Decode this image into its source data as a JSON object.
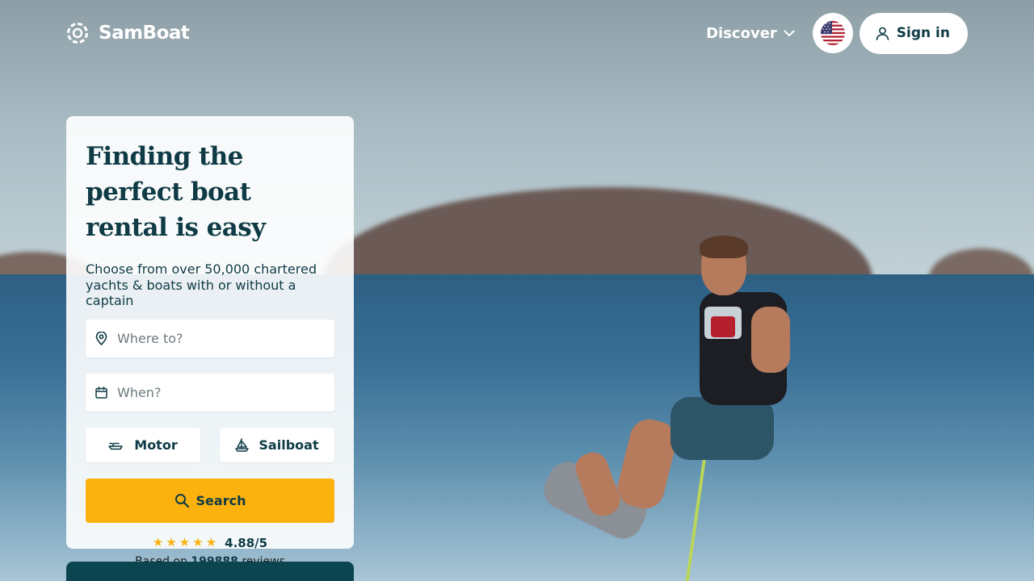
{
  "brand": {
    "name": "SamBoat"
  },
  "nav": {
    "discover_label": "Discover",
    "language_flag": "us-flag-icon",
    "signin_label": "Sign in"
  },
  "search_card": {
    "title": "Finding the perfect boat rental is easy",
    "subtitle": "Choose from over 50,000 chartered yachts & boats with or without a captain",
    "where_placeholder": "Where to?",
    "when_placeholder": "When?",
    "boat_types": [
      "Motor",
      "Sailboat"
    ],
    "search_label": "Search",
    "rating": {
      "stars": 5,
      "value": "4.88/5",
      "reviews_prefix": "Based on",
      "reviews_count": "199888",
      "reviews_suffix": "reviews"
    }
  },
  "colors": {
    "primary": "#0e3b45",
    "accent": "#fbb20f",
    "bottom_bar": "#0b4650"
  },
  "icons": {
    "location": "map-pin-icon",
    "calendar": "calendar-icon",
    "motor": "motorboat-icon",
    "sailboat": "sailboat-icon",
    "search": "search-icon",
    "user": "user-icon",
    "chevron": "chevron-down-icon"
  }
}
